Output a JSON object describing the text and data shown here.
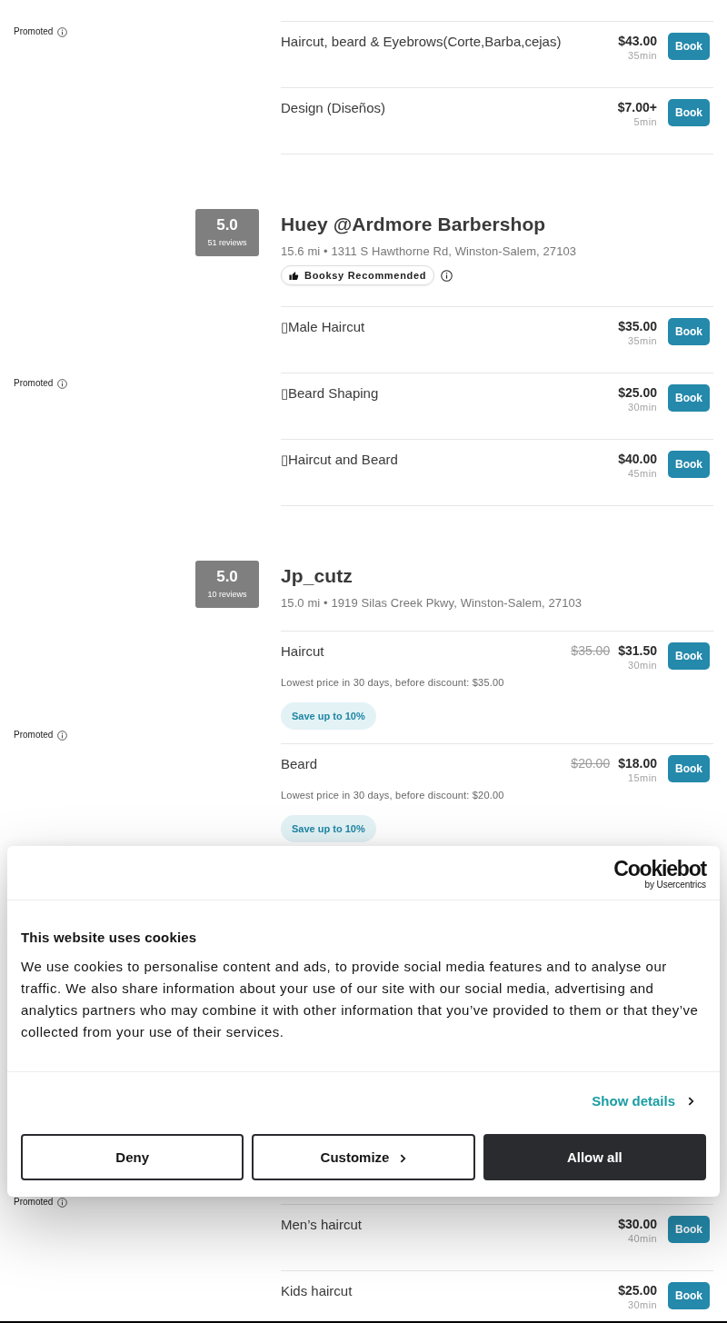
{
  "shops": [
    {
      "promoted_label": "Promoted",
      "services": [
        {
          "name": "Haircut, beard & Eyebrows(Corte,Barba,cejas)",
          "price": "$43.00",
          "duration": "35min",
          "button": "Book"
        },
        {
          "name": "Design (Diseños)",
          "price": "$7.00+",
          "duration": "5min",
          "button": "Book"
        }
      ]
    },
    {
      "promoted_label": "Promoted",
      "rating": {
        "score": "5.0",
        "reviews": "51 reviews"
      },
      "name": "Huey @Ardmore Barbershop",
      "address": "15.6 mi • 1311 S Hawthorne Rd, Winston-Salem, 27103",
      "recommended_badge": "Booksy Recommended",
      "services": [
        {
          "name": "▯Male Haircut",
          "price": "$35.00",
          "duration": "35min",
          "button": "Book"
        },
        {
          "name": "▯Beard Shaping",
          "price": "$25.00",
          "duration": "30min",
          "button": "Book"
        },
        {
          "name": "▯Haircut and Beard",
          "price": "$40.00",
          "duration": "45min",
          "button": "Book"
        }
      ]
    },
    {
      "promoted_label": "Promoted",
      "rating": {
        "score": "5.0",
        "reviews": "10 reviews"
      },
      "name": "Jp_cutz",
      "address": "15.0 mi • 1919 Silas Creek Pkwy, Winston-Salem, 27103",
      "services": [
        {
          "name": "Haircut",
          "old_price": "$35.00",
          "price": "$31.50",
          "duration": "30min",
          "button": "Book",
          "note": "Lowest price in 30 days, before discount: $35.00",
          "promo": "Save up to 10%"
        },
        {
          "name": "Beard",
          "old_price": "$20.00",
          "price": "$18.00",
          "duration": "15min",
          "button": "Book",
          "note": "Lowest price in 30 days, before discount: $20.00",
          "promo": "Save up to 10%"
        }
      ]
    },
    {
      "promoted_label": "Promoted",
      "services": [
        {
          "name": "Men’s haircut",
          "price": "$30.00",
          "duration": "40min",
          "button": "Book"
        },
        {
          "name": "Kids haircut",
          "price": "$25.00",
          "duration": "30min",
          "button": "Book"
        }
      ]
    }
  ],
  "cookie_banner": {
    "logo": {
      "wordmark": "Cookiebot",
      "byline": "by Usercentrics"
    },
    "title": "This website uses cookies",
    "text": "We use cookies to personalise content and ads, to provide social media features and to analyse our traffic. We also share information about your use of our site with our social media, advertising and analytics partners who may combine it with other information that you’ve provided to them or that they’ve collected from your use of their services.",
    "details_link": "Show details",
    "buttons": [
      {
        "label": "Deny",
        "kind": "outline",
        "chevron": false
      },
      {
        "label": "Customize",
        "kind": "outline",
        "chevron": true
      },
      {
        "label": "Allow all",
        "kind": "primary",
        "chevron": false
      }
    ]
  }
}
